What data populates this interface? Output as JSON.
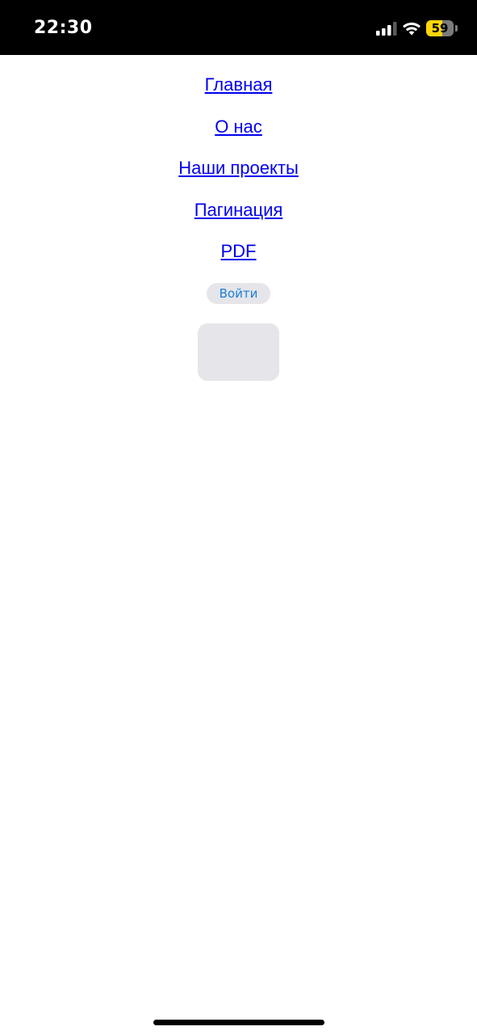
{
  "status_bar": {
    "time": "22:30",
    "signal_icon": "cellular-signal-icon",
    "wifi_icon": "wifi-icon",
    "battery_level": "59",
    "battery_percent": 59,
    "battery_color": "#ffd60a"
  },
  "nav": {
    "links": [
      {
        "label": "Главная"
      },
      {
        "label": "О нас"
      },
      {
        "label": "Наши проекты"
      },
      {
        "label": "Пагинация"
      },
      {
        "label": "PDF"
      }
    ]
  },
  "login": {
    "label": "Войти"
  },
  "colors": {
    "link": "#0000ee",
    "button_text": "#1a7fd6",
    "button_bg": "#e5e5ea"
  }
}
